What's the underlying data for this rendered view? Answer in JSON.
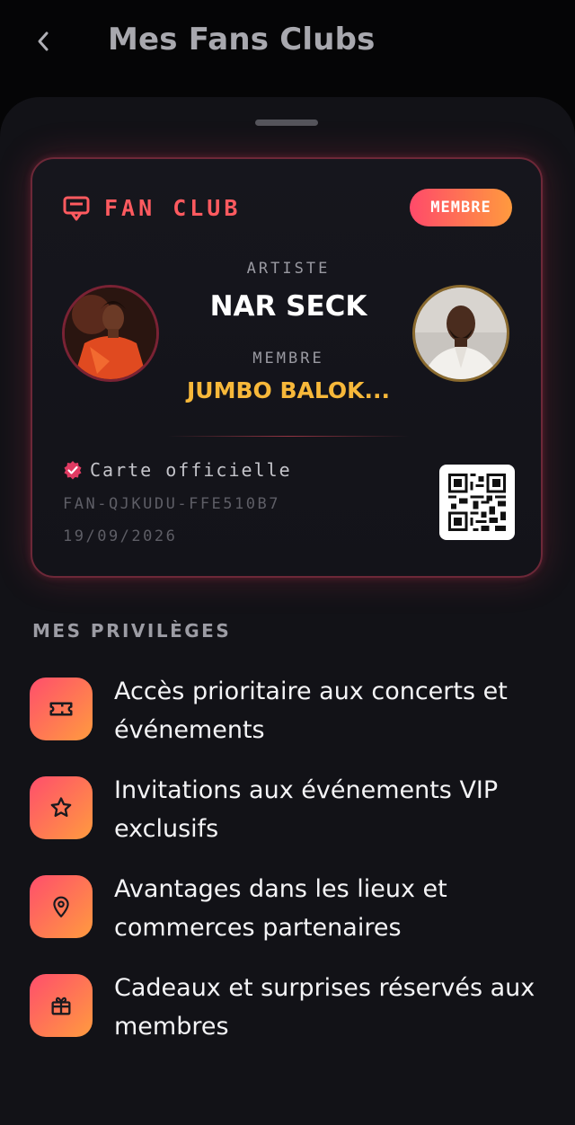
{
  "header": {
    "title": "Mes Fans Clubs",
    "back_icon": "chevron-left-icon"
  },
  "card": {
    "label": "FAN CLUB",
    "label_icon": "id-card-icon",
    "badge": "MEMBRE",
    "artist_label": "ARTISTE",
    "artist_name": "NAR SECK",
    "member_label": "MEMBRE",
    "member_name": "JUMBO BALOK...",
    "official_text": "Carte officielle",
    "card_code": "FAN-QJKUDU-FFE510B7",
    "date": "19/09/2026"
  },
  "privileges": {
    "title": "MES PRIVILÈGES",
    "items": [
      {
        "icon": "ticket-icon",
        "text": "Accès prioritaire aux concerts et événements"
      },
      {
        "icon": "star-icon",
        "text": "Invitations aux événements VIP exclusifs"
      },
      {
        "icon": "map-pin-icon",
        "text": "Avantages dans les lieux et commerces partenaires"
      },
      {
        "icon": "gift-icon",
        "text": "Cadeaux et surprises réservés aux membres"
      }
    ]
  },
  "colors": {
    "accent_start": "#ff4e6c",
    "accent_end": "#ff9b3f",
    "member_name": "#f7b83a",
    "background": "#050506",
    "sheet": "#121217"
  }
}
